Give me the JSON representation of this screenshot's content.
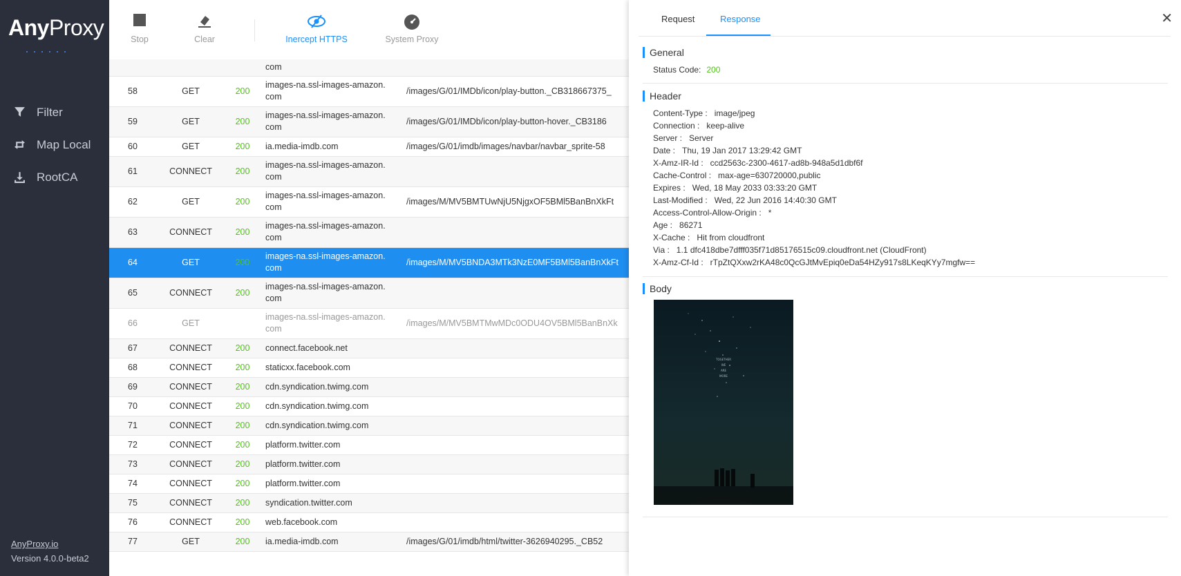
{
  "sidebar": {
    "logo_bold": "Any",
    "logo_light": "Proxy",
    "items": [
      {
        "label": "Filter",
        "icon": "filter-icon"
      },
      {
        "label": "Map Local",
        "icon": "map-local-icon"
      },
      {
        "label": "RootCA",
        "icon": "download-icon"
      }
    ],
    "footer_link": "AnyProxy.io",
    "version": "Version 4.0.0-beta2"
  },
  "toolbar": {
    "stop": "Stop",
    "clear": "Clear",
    "intercept": "Inercept HTTPS",
    "system_proxy": "System Proxy"
  },
  "rows": [
    {
      "id": "",
      "method": "",
      "code": "",
      "host": "com",
      "path": ""
    },
    {
      "id": "58",
      "method": "GET",
      "code": "200",
      "host": "images-na.ssl-images-amazon.\ncom",
      "path": "/images/G/01/IMDb/icon/play-button._CB318667375_"
    },
    {
      "id": "59",
      "method": "GET",
      "code": "200",
      "host": "images-na.ssl-images-amazon.\ncom",
      "path": "/images/G/01/IMDb/icon/play-button-hover._CB3186"
    },
    {
      "id": "60",
      "method": "GET",
      "code": "200",
      "host": "ia.media-imdb.com",
      "path": "/images/G/01/imdb/images/navbar/navbar_sprite-58"
    },
    {
      "id": "61",
      "method": "CONNECT",
      "code": "200",
      "host": "images-na.ssl-images-amazon.\ncom",
      "path": ""
    },
    {
      "id": "62",
      "method": "GET",
      "code": "200",
      "host": "images-na.ssl-images-amazon.\ncom",
      "path": "/images/M/MV5BMTUwNjU5NjgxOF5BMl5BanBnXkFt"
    },
    {
      "id": "63",
      "method": "CONNECT",
      "code": "200",
      "host": "images-na.ssl-images-amazon.\ncom",
      "path": ""
    },
    {
      "id": "64",
      "method": "GET",
      "code": "200",
      "host": "images-na.ssl-images-amazon.\ncom",
      "path": "/images/M/MV5BNDA3MTk3NzE0MF5BMl5BanBnXkFt"
    },
    {
      "id": "65",
      "method": "CONNECT",
      "code": "200",
      "host": "images-na.ssl-images-amazon.\ncom",
      "path": ""
    },
    {
      "id": "66",
      "method": "GET",
      "code": "",
      "host": "images-na.ssl-images-amazon.\ncom",
      "path": "/images/M/MV5BMTMwMDc0ODU4OV5BMl5BanBnXk"
    },
    {
      "id": "67",
      "method": "CONNECT",
      "code": "200",
      "host": "connect.facebook.net",
      "path": ""
    },
    {
      "id": "68",
      "method": "CONNECT",
      "code": "200",
      "host": "staticxx.facebook.com",
      "path": ""
    },
    {
      "id": "69",
      "method": "CONNECT",
      "code": "200",
      "host": "cdn.syndication.twimg.com",
      "path": ""
    },
    {
      "id": "70",
      "method": "CONNECT",
      "code": "200",
      "host": "cdn.syndication.twimg.com",
      "path": ""
    },
    {
      "id": "71",
      "method": "CONNECT",
      "code": "200",
      "host": "cdn.syndication.twimg.com",
      "path": ""
    },
    {
      "id": "72",
      "method": "CONNECT",
      "code": "200",
      "host": "platform.twitter.com",
      "path": ""
    },
    {
      "id": "73",
      "method": "CONNECT",
      "code": "200",
      "host": "platform.twitter.com",
      "path": ""
    },
    {
      "id": "74",
      "method": "CONNECT",
      "code": "200",
      "host": "platform.twitter.com",
      "path": ""
    },
    {
      "id": "75",
      "method": "CONNECT",
      "code": "200",
      "host": "syndication.twitter.com",
      "path": ""
    },
    {
      "id": "76",
      "method": "CONNECT",
      "code": "200",
      "host": "web.facebook.com",
      "path": ""
    },
    {
      "id": "77",
      "method": "GET",
      "code": "200",
      "host": "ia.media-imdb.com",
      "path": "/images/G/01/imdb/html/twitter-3626940295._CB52"
    }
  ],
  "panel": {
    "tab_request": "Request",
    "tab_response": "Response",
    "close": "✕",
    "general_title": "General",
    "status_label": "Status Code:",
    "status_value": "200",
    "header_title": "Header",
    "headers": [
      {
        "k": "Content-Type :",
        "v": "image/jpeg"
      },
      {
        "k": "Connection :",
        "v": "keep-alive"
      },
      {
        "k": "Server :",
        "v": "Server"
      },
      {
        "k": "Date :",
        "v": "Thu, 19 Jan 2017 13:29:42 GMT"
      },
      {
        "k": "X-Amz-IR-Id :",
        "v": "ccd2563c-2300-4617-ad8b-948a5d1dbf6f"
      },
      {
        "k": "Cache-Control :",
        "v": "max-age=630720000,public"
      },
      {
        "k": "Expires :",
        "v": "Wed, 18 May 2033 03:33:20 GMT"
      },
      {
        "k": "Last-Modified :",
        "v": "Wed, 22 Jun 2016 14:40:30 GMT"
      },
      {
        "k": "Access-Control-Allow-Origin :",
        "v": "*"
      },
      {
        "k": "Age :",
        "v": "86271"
      },
      {
        "k": "X-Cache :",
        "v": "Hit from cloudfront"
      },
      {
        "k": "Via :",
        "v": "1.1 dfc418dbe7dfff035f71d85176515c09.cloudfront.net (CloudFront)"
      },
      {
        "k": "X-Amz-Cf-Id :",
        "v": "rTpZtQXxw2rKA48c0QcGJtMvEpiq0eDa54HZy917s8LKeqKYy7mgfw=="
      }
    ],
    "body_title": "Body",
    "poster_text": "TOGETHER\nWE\nARE\nMORE"
  },
  "colors": {
    "accent": "#1890ff",
    "ok": "#52c41a",
    "sidebar": "#2b2f3b",
    "selected": "#1f8ef1"
  }
}
